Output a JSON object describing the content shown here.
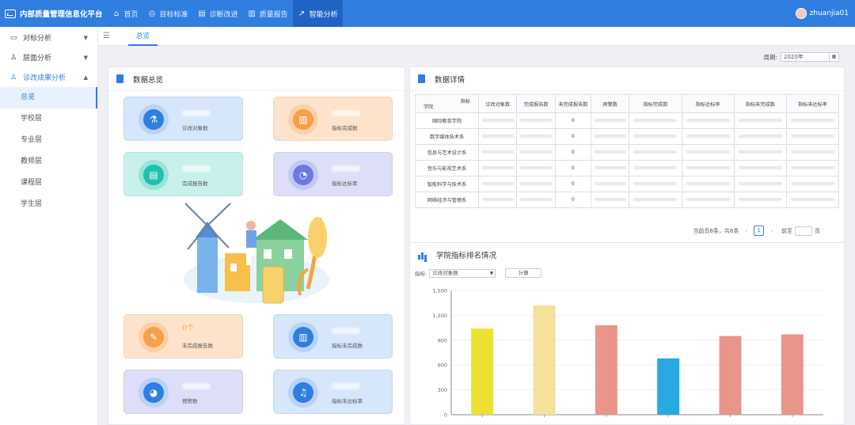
{
  "brand": {
    "title": "内部质量管理信息化平台"
  },
  "nav": [
    {
      "icon": "home-icon",
      "label": "首页"
    },
    {
      "icon": "target-icon",
      "label": "目标标准"
    },
    {
      "icon": "document-icon",
      "label": "诊断改进"
    },
    {
      "icon": "report-icon",
      "label": "质量报告"
    },
    {
      "icon": "trend-chart-icon",
      "label": "智能分析"
    }
  ],
  "user": {
    "name": "zhuanjia01"
  },
  "sidebar": {
    "groups": [
      {
        "label": "对标分析",
        "icon": "monitor-icon"
      },
      {
        "label": "层面分析",
        "icon": "layers-icon"
      },
      {
        "label": "诊改成果分析",
        "icon": "thumbs-up-icon"
      }
    ],
    "items": [
      "总览",
      "学校层",
      "专业层",
      "教师层",
      "课程层",
      "学生层"
    ]
  },
  "tab": {
    "label": "总览"
  },
  "filter": {
    "label": "周期:",
    "value": "2020年"
  },
  "overview": {
    "title": "数据总览",
    "cards": [
      {
        "label": "诊改对象数",
        "value": ""
      },
      {
        "label": "指标完成数",
        "value": ""
      },
      {
        "label": "完成报告数",
        "value": ""
      },
      {
        "label": "指标达标率",
        "value": ""
      },
      {
        "label": "未完成报告数",
        "value": "0个"
      },
      {
        "label": "指标未完成数",
        "value": ""
      },
      {
        "label": "预警数",
        "value": ""
      },
      {
        "label": "指标未达标率",
        "value": ""
      }
    ]
  },
  "details": {
    "title": "数据详情",
    "header_corner_top": "指标",
    "header_corner_bottom": "学院",
    "columns": [
      "诊改对象数",
      "完成报告数",
      "未完成报告数",
      "预警数",
      "指标完成数",
      "指标达标率",
      "指标未完成数",
      "指标未达标率"
    ],
    "rows": [
      {
        "name": "国际教育学院",
        "unfinished": "0"
      },
      {
        "name": "数字媒体技术系",
        "unfinished": "0"
      },
      {
        "name": "信息与艺术设计系",
        "unfinished": "0"
      },
      {
        "name": "音乐与影视艺术系",
        "unfinished": "0"
      },
      {
        "name": "智能科学与技术系",
        "unfinished": "0"
      },
      {
        "name": "网络经济与管理系",
        "unfinished": "0"
      }
    ],
    "pager": {
      "summary": "当前页6条，共6条",
      "current": "1",
      "goto": "前至",
      "page_suffix": "页"
    }
  },
  "ranking": {
    "title": "学院指标排名情况",
    "metric_label": "指标:",
    "metric_value": "诊改对象数",
    "compute_label": "计算"
  },
  "chart_data": {
    "type": "bar",
    "categories": [
      "国际教育学院",
      "数字媒体技术系",
      "信息与艺术设计系",
      "音乐与影视艺术系",
      "智能科学与技术系",
      "网络经济与管理系"
    ],
    "values": [
      1040,
      1320,
      1080,
      680,
      950,
      970
    ],
    "colors": [
      "#ece133",
      "#f5e19a",
      "#e8968a",
      "#27a9e1",
      "#e8968a",
      "#e8968a"
    ],
    "ylim": [
      0,
      1500
    ],
    "yticks": [
      "0",
      "300",
      "600",
      "900",
      "1,200",
      "1,500"
    ],
    "title": "",
    "xlabel": "",
    "ylabel": ""
  }
}
